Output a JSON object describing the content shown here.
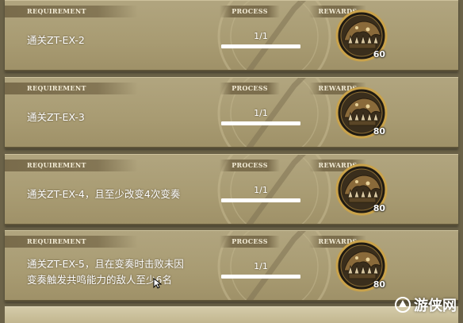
{
  "headers": {
    "requirement": "REQUIREMENT",
    "process": "PROCESS",
    "rewards": "REWARDS"
  },
  "missions": [
    {
      "requirement": [
        "通关ZT-EX-2"
      ],
      "progress": "1/1",
      "progress_fraction": 1.0,
      "reward_icon": "mechanical-beast-icon",
      "reward_count": "60"
    },
    {
      "requirement": [
        "通关ZT-EX-3"
      ],
      "progress": "1/1",
      "progress_fraction": 1.0,
      "reward_icon": "mechanical-beast-icon",
      "reward_count": "80"
    },
    {
      "requirement": [
        "通关ZT-EX-4，且至少改变4次变奏"
      ],
      "progress": "1/1",
      "progress_fraction": 1.0,
      "reward_icon": "mechanical-beast-icon",
      "reward_count": "80"
    },
    {
      "requirement": [
        "通关ZT-EX-5，且在变奏时击败未因",
        "变奏触发共鸣能力的敌人至少6名"
      ],
      "progress": "1/1",
      "progress_fraction": 1.0,
      "reward_icon": "mechanical-beast-icon",
      "reward_count": "80"
    }
  ],
  "watermark": {
    "text": "游侠网",
    "icon": "watermark-logo-icon"
  },
  "colors": {
    "card": "#ab9e76",
    "header_band": "#766848",
    "bar_track": "#6a5f44",
    "bar_fill": "#ffffff",
    "reward_ring": "#c9a24a"
  }
}
